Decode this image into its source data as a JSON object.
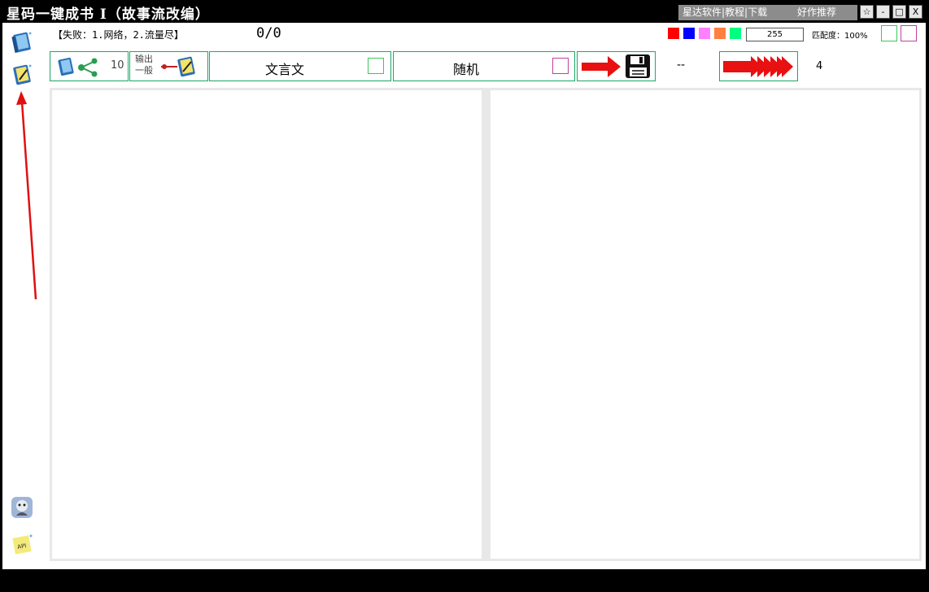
{
  "window": {
    "title": "星码一键成书 I（故事流改编）",
    "links_left": "星达软件|教程|下载",
    "links_right": "好作推荐",
    "btn_star": "☆",
    "btn_min": "-",
    "btn_max": "□",
    "btn_close": "X"
  },
  "status": {
    "message": "【失败：1.网络，2.流量尽】",
    "progress": "0/0",
    "colors": [
      "#ff0000",
      "#0000ff",
      "#ff80ff",
      "#ff8040",
      "#00ff80"
    ],
    "value": "255",
    "match_label": "匹配度：100%"
  },
  "toolbar": {
    "count": "10",
    "output_line1": "输出",
    "output_line2": "一般",
    "classical_label": "文言文",
    "random_label": "随机",
    "dashes": "--",
    "number": "4"
  },
  "sidebar": {
    "icons": [
      "book-icon",
      "edit-book-icon",
      "avatar-icon",
      "api-note-icon"
    ]
  },
  "annotation": {
    "arrow_color": "#e01010"
  }
}
